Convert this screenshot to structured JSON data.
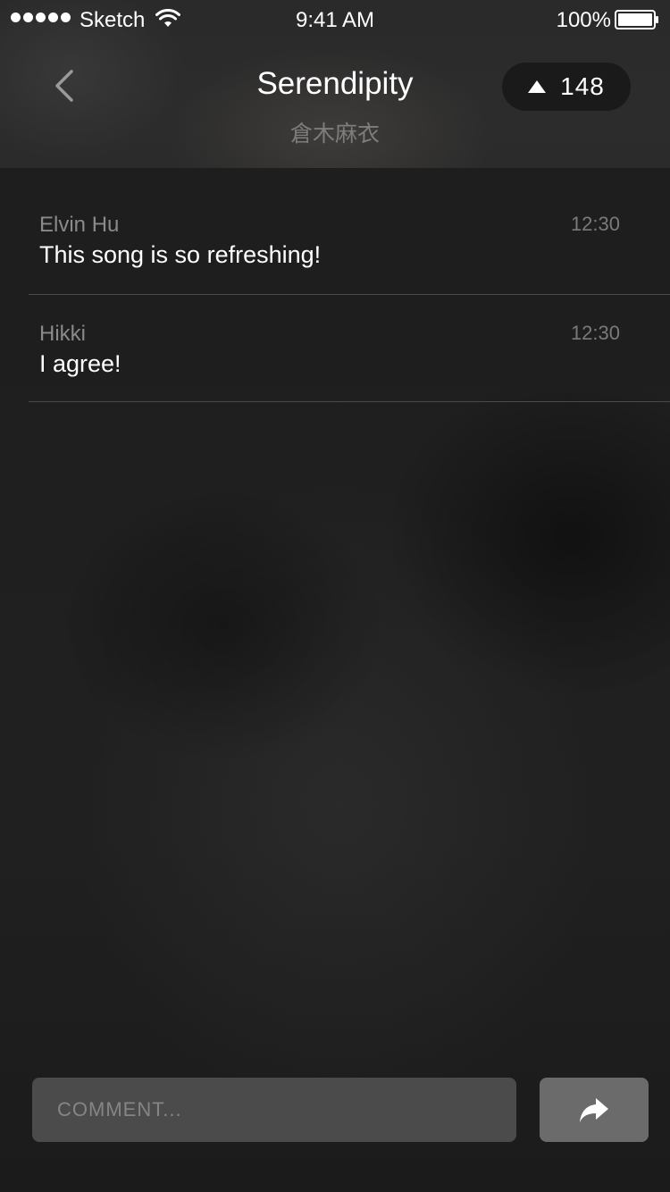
{
  "status_bar": {
    "carrier": "Sketch",
    "time": "9:41 AM",
    "battery": "100%"
  },
  "header": {
    "title": "Serendipity",
    "subtitle": "倉木麻衣",
    "vote_count": "148"
  },
  "comments": [
    {
      "author": "Elvin Hu",
      "text": "This song is so refreshing!",
      "time": "12:30"
    },
    {
      "author": "Hikki",
      "text": "I agree!",
      "time": "12:30"
    }
  ],
  "composer": {
    "placeholder": "COMMENT..."
  },
  "icons": {
    "back": "chevron-left-icon",
    "vote": "triangle-up-icon",
    "share": "share-arrow-icon"
  }
}
